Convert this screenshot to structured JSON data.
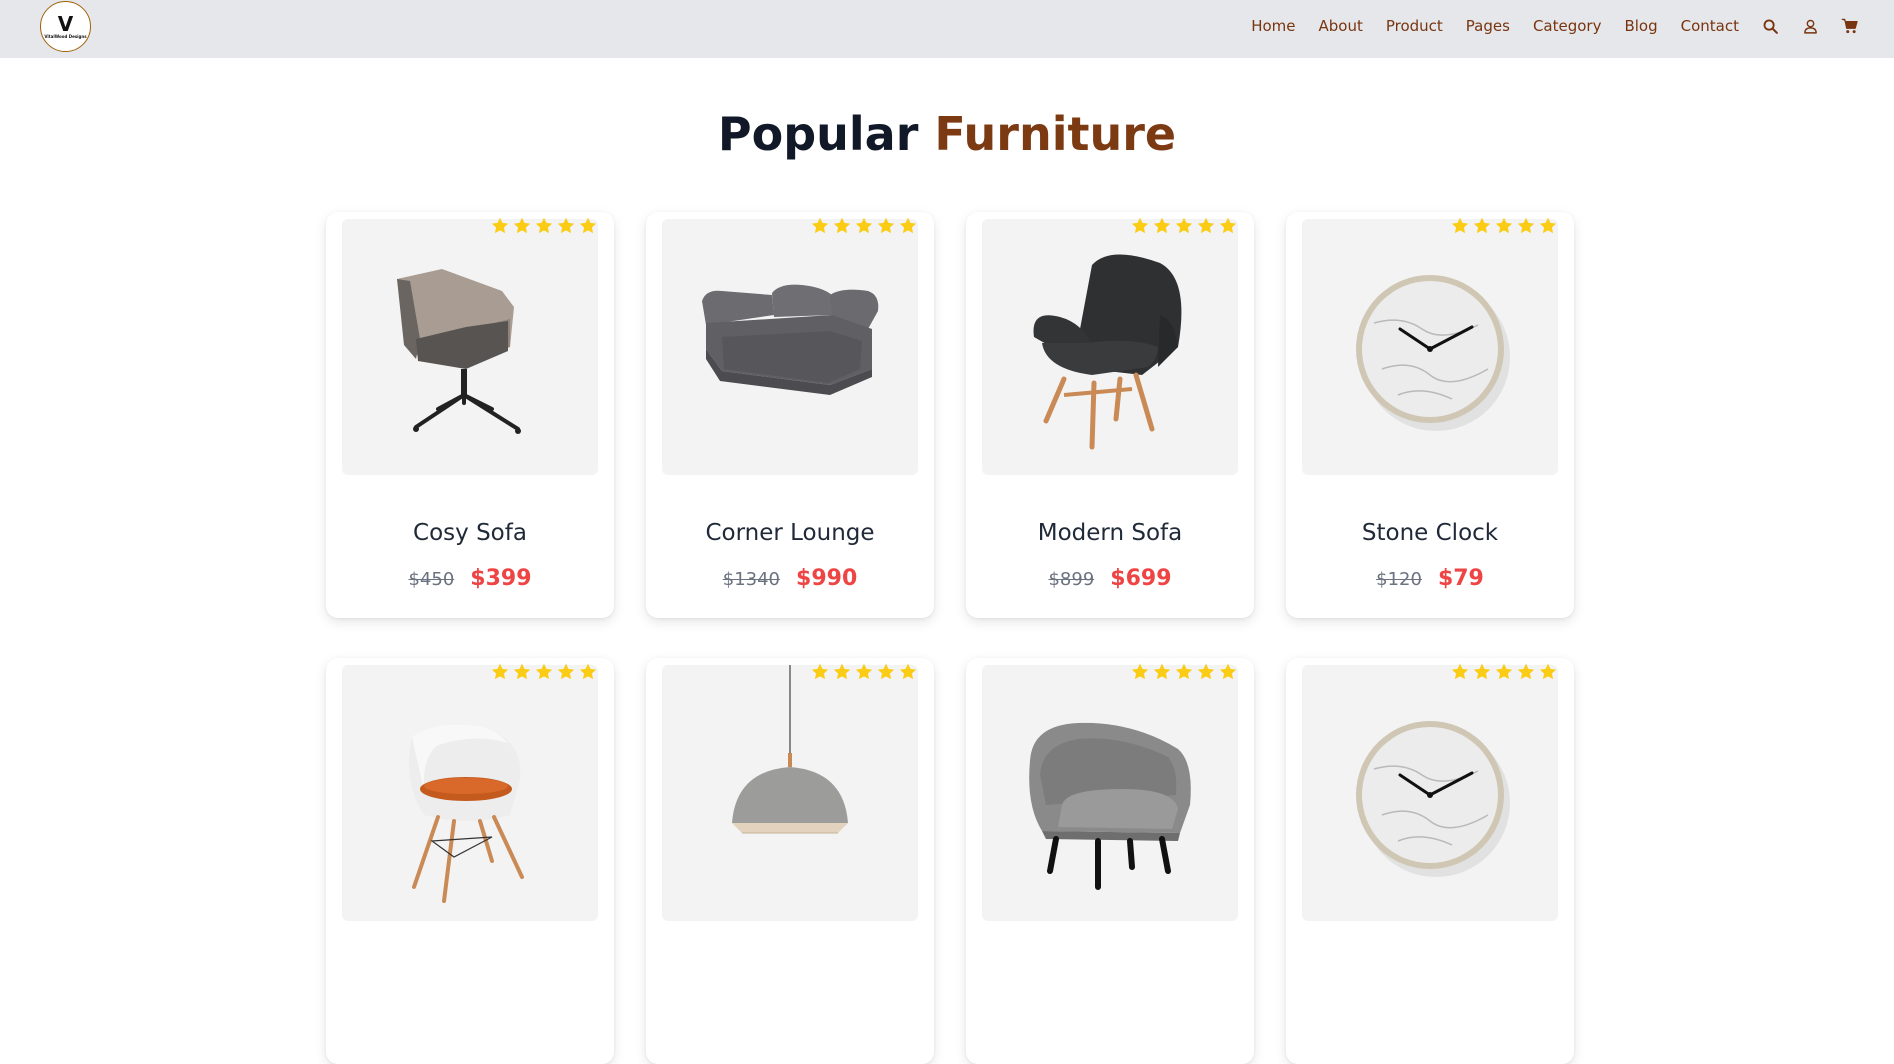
{
  "brand": {
    "logo_mark": "V",
    "logo_text": "VitalWood Designs"
  },
  "nav": {
    "links": [
      "Home",
      "About",
      "Product",
      "Pages",
      "Category",
      "Blog",
      "Contact"
    ],
    "icons": [
      "search-icon",
      "user-icon",
      "cart-icon"
    ],
    "link_color": "#78350f"
  },
  "section": {
    "title_part1": "Popular",
    "title_part2": "Furniture",
    "accent_color": "#7c3a12"
  },
  "products": [
    {
      "name": "Cosy Sofa",
      "old_price": "$450",
      "new_price": "$399",
      "rating": 5,
      "image": "swivel-armchair"
    },
    {
      "name": "Corner Lounge",
      "old_price": "$1340",
      "new_price": "$990",
      "rating": 5,
      "image": "corner-sofa"
    },
    {
      "name": "Modern Sofa",
      "old_price": "$899",
      "new_price": "$699",
      "rating": 5,
      "image": "wingback-chair"
    },
    {
      "name": "Stone Clock",
      "old_price": "$120",
      "new_price": "$79",
      "rating": 5,
      "image": "marble-clock"
    },
    {
      "name": "",
      "old_price": "",
      "new_price": "",
      "rating": 5,
      "image": "eames-chair"
    },
    {
      "name": "",
      "old_price": "",
      "new_price": "",
      "rating": 5,
      "image": "pendant-lamp"
    },
    {
      "name": "",
      "old_price": "",
      "new_price": "",
      "rating": 5,
      "image": "grey-armchair"
    },
    {
      "name": "",
      "old_price": "",
      "new_price": "",
      "rating": 5,
      "image": "marble-clock"
    }
  ],
  "colors": {
    "star": "#facc15",
    "sale_price": "#ef4444",
    "header_bg": "#e5e7eb"
  }
}
